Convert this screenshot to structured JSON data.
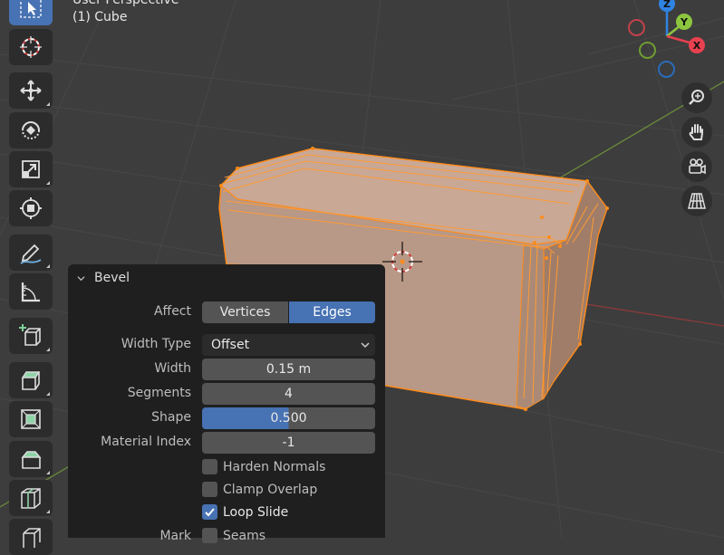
{
  "viewport": {
    "perspective_label": "User Perspective",
    "object_label": "(1) Cube"
  },
  "gizmo": {
    "z": "Z",
    "y": "Y",
    "x": "X"
  },
  "toolbar": {
    "tools": [
      {
        "name": "select-box-tool",
        "icon": "cursor-select-icon",
        "active": true
      },
      {
        "name": "cursor-tool",
        "icon": "3d-cursor-icon"
      },
      {
        "name": "move-tool",
        "icon": "move-arrows-icon"
      },
      {
        "name": "rotate-tool",
        "icon": "rotate-icon"
      },
      {
        "name": "scale-tool",
        "icon": "scale-icon"
      },
      {
        "name": "transform-tool",
        "icon": "transform-icon"
      },
      {
        "name": "annotate-tool",
        "icon": "pencil-icon"
      },
      {
        "name": "measure-tool",
        "icon": "ruler-icon"
      },
      {
        "name": "add-cube-tool",
        "icon": "add-cube-icon"
      },
      {
        "name": "extrude-tool",
        "icon": "extrude-icon"
      },
      {
        "name": "inset-tool",
        "icon": "inset-faces-icon"
      },
      {
        "name": "bevel-tool",
        "icon": "bevel-icon"
      },
      {
        "name": "loop-cut-tool",
        "icon": "loop-cut-icon"
      },
      {
        "name": "knife-tool",
        "icon": "knife-icon"
      }
    ]
  },
  "nav": [
    "zoom-icon",
    "hand-pan-icon",
    "camera-icon",
    "grid-perspective-icon"
  ],
  "bevel": {
    "title": "Bevel",
    "affect_label": "Affect",
    "affect_options": [
      "Vertices",
      "Edges"
    ],
    "affect_selected": "Edges",
    "width_type_label": "Width Type",
    "width_type_value": "Offset",
    "width_label": "Width",
    "width_value": "0.15 m",
    "segments_label": "Segments",
    "segments_value": "4",
    "shape_label": "Shape",
    "shape_value": "0.500",
    "shape_fill": 0.5,
    "material_index_label": "Material Index",
    "material_index_value": "-1",
    "harden_normals": {
      "label": "Harden Normals",
      "checked": false
    },
    "clamp_overlap": {
      "label": "Clamp Overlap",
      "checked": false
    },
    "loop_slide": {
      "label": "Loop Slide",
      "checked": true
    },
    "mark_label": "Mark",
    "seams": {
      "label": "Seams",
      "checked": false
    }
  },
  "colors": {
    "accent": "#4772b3",
    "selection": "#ff8c1a",
    "x_axis": "#e8414f",
    "y_axis": "#8cc63f",
    "z_axis": "#2f84e3"
  }
}
